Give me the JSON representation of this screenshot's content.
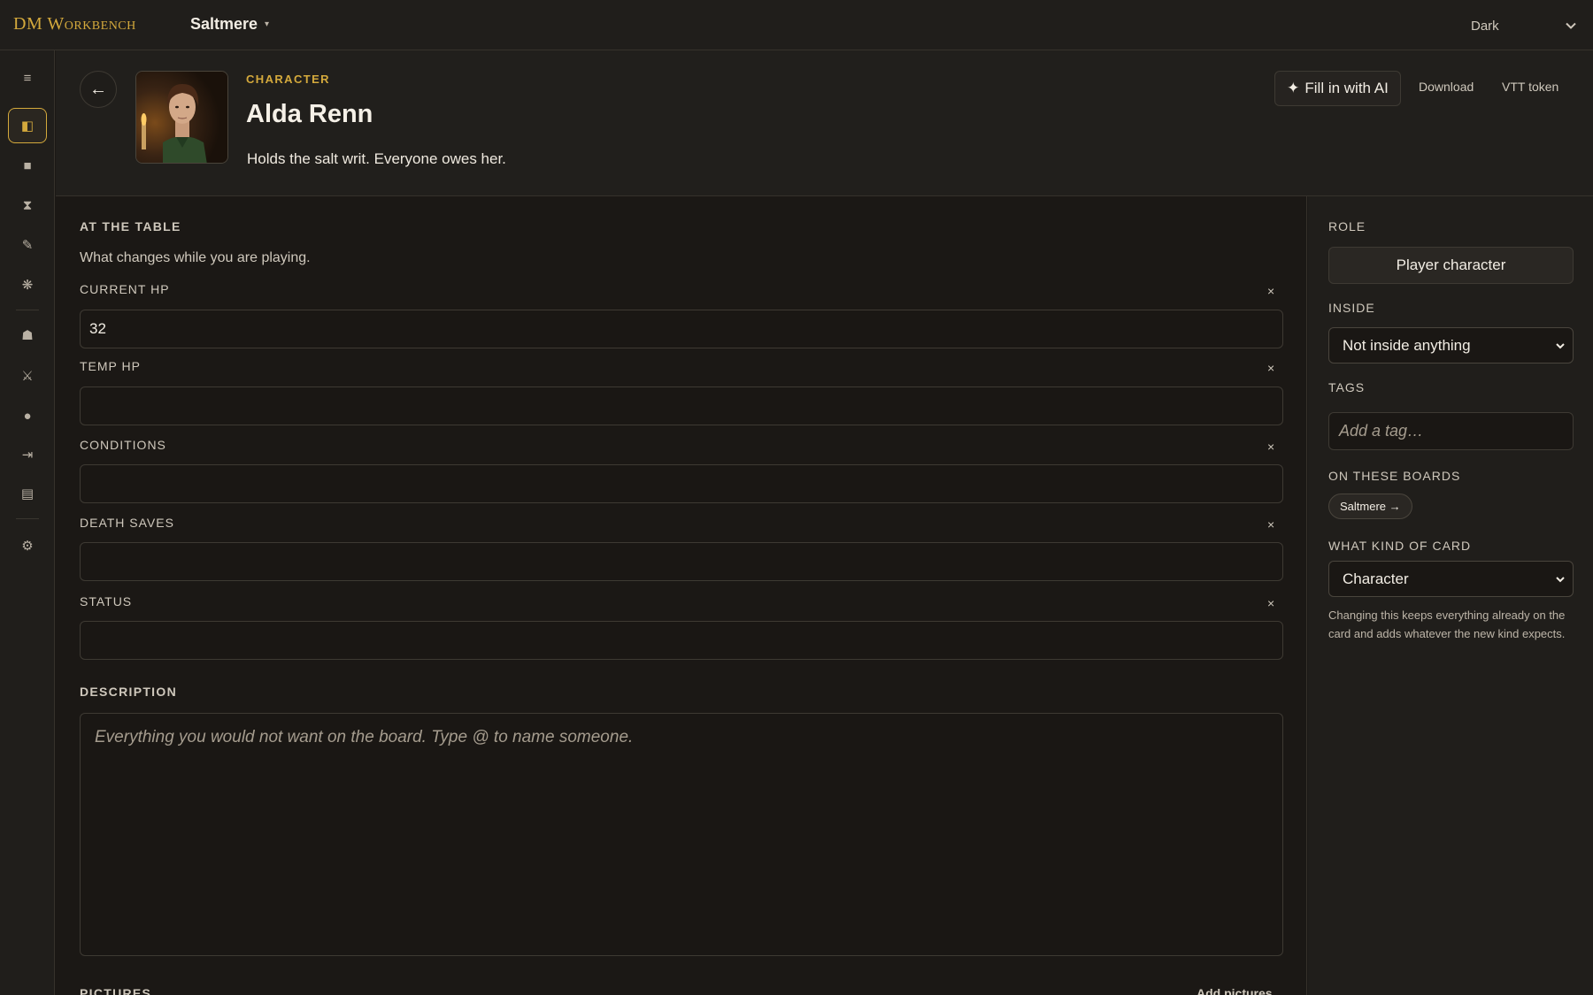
{
  "app": {
    "brand": "DM Workbench",
    "workspace": "Saltmere",
    "theme": "Dark"
  },
  "rail": {
    "icons": [
      "menu-icon",
      "card-icon",
      "square-icon",
      "hourglass-icon",
      "pen-icon",
      "sparkle-icon",
      "bell-icon",
      "swords-icon",
      "dot-icon",
      "export-icon",
      "list-icon",
      "gear-icon"
    ],
    "glyphs": [
      "≡",
      "◧",
      "■",
      "⧗",
      "✎",
      "❋",
      "☗",
      "⚔",
      "●",
      "⇥",
      "▤",
      "⚙"
    ]
  },
  "header": {
    "kind": "CHARACTER",
    "title": "Alda Renn",
    "subtitle": "Holds the salt writ. Everyone owes her.",
    "ai_button": "Fill in with AI",
    "download": "Download",
    "vtt_token": "VTT token"
  },
  "main": {
    "at_table_heading": "AT THE TABLE",
    "at_table_sub": "What changes while you are playing.",
    "fields": [
      {
        "label": "CURRENT HP",
        "value": "32"
      },
      {
        "label": "TEMP HP",
        "value": ""
      },
      {
        "label": "CONDITIONS",
        "value": ""
      },
      {
        "label": "DEATH SAVES",
        "value": ""
      },
      {
        "label": "STATUS",
        "value": ""
      }
    ],
    "clear_glyph": "×",
    "description_heading": "DESCRIPTION",
    "description_placeholder": "Everything you would not want on the board. Type @ to name someone.",
    "pictures_heading": "PICTURES",
    "add_pictures": "Add pictures"
  },
  "side": {
    "role_label": "ROLE",
    "role_value": "Player character",
    "inside_label": "INSIDE",
    "inside_value": "Not inside anything",
    "tags_label": "TAGS",
    "tags_placeholder": "Add a tag…",
    "boards_label": "ON THESE BOARDS",
    "board_chip": "Saltmere →",
    "kind_label": "WHAT KIND OF CARD",
    "kind_value": "Character",
    "kind_note": "Changing this keeps everything already on the card and adds whatever the new kind expects."
  },
  "colors": {
    "accent": "#d4a93c",
    "background": "#1b1815",
    "panel": "#201e1b"
  }
}
